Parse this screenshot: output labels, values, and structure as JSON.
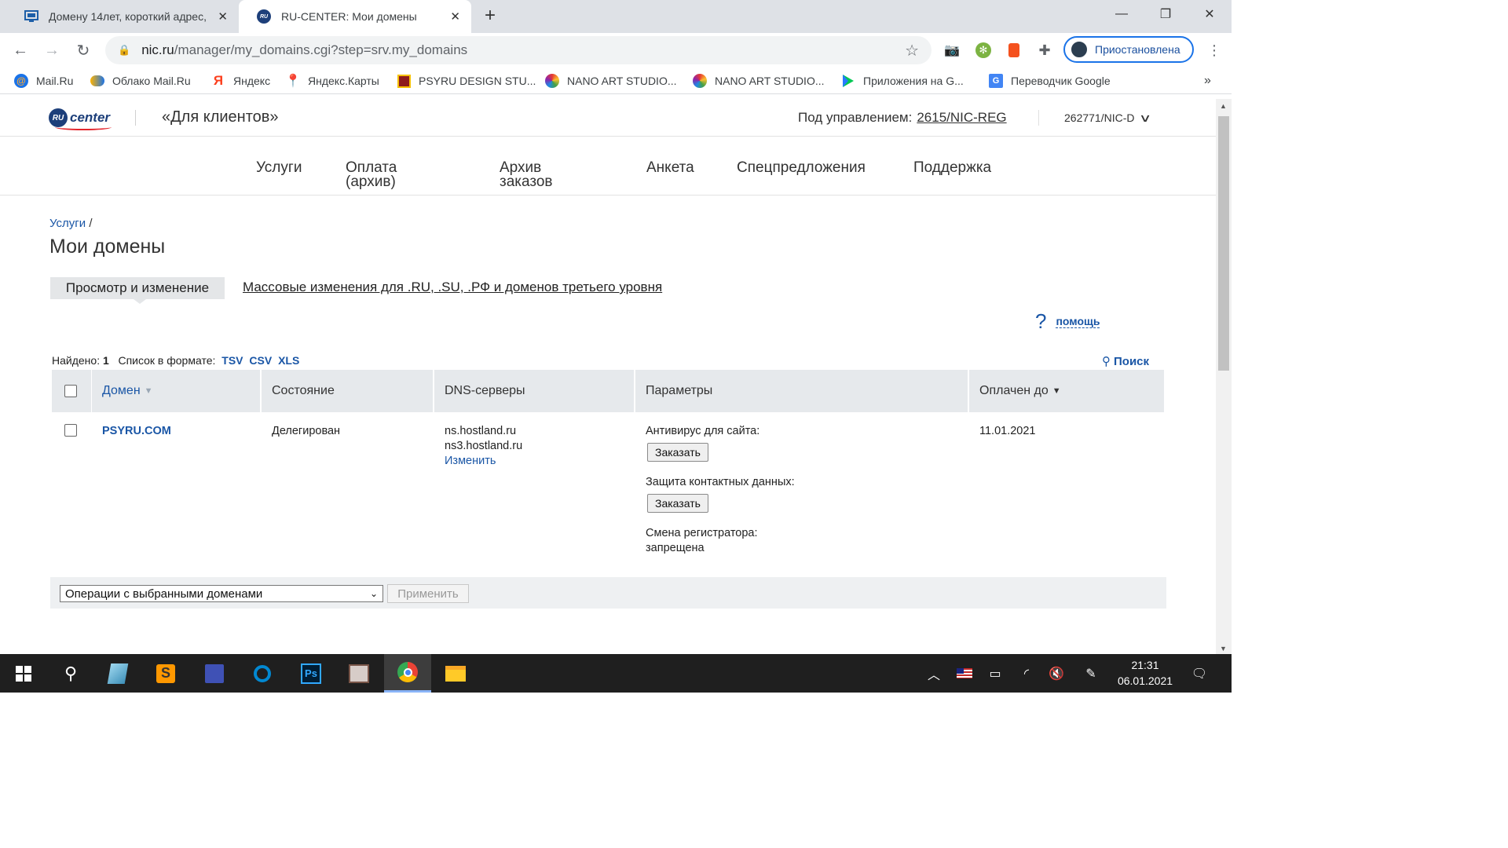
{
  "browser": {
    "tabs": [
      {
        "title": "Домену 14лет, короткий адрес,",
        "close": "✕"
      },
      {
        "title": "RU-CENTER: Мои домены",
        "close": "✕"
      }
    ],
    "new_tab": "+",
    "window_controls": {
      "minimize": "—",
      "maximize": "❐",
      "close": "✕"
    },
    "url_host": "nic.ru",
    "url_path": "/manager/my_domains.cgi?step=srv.my_domains",
    "profile_label": "Приостановлена",
    "bookmarks": [
      "Mail.Ru",
      "Облако Mail.Ru",
      "Яндекс",
      "Яндекс.Карты",
      "PSYRU DESIGN STU...",
      "NANO ART STUDIO...",
      "NANO ART STUDIO...",
      "Приложения на G...",
      "Переводчик Google"
    ],
    "bookmarks_more": "»"
  },
  "site": {
    "logo_badge": "RU",
    "logo_text": "center",
    "section": "«Для клиентов»",
    "managed_label": "Под управлением:",
    "managed_value": "2615/NIC-REG",
    "account": "262771/NIC-D",
    "nav": [
      {
        "line1": "Услуги",
        "line2": ""
      },
      {
        "line1": "Оплата",
        "line2": "(архив)"
      },
      {
        "line1": "Архив",
        "line2": "заказов"
      },
      {
        "line1": "Анкета",
        "line2": ""
      },
      {
        "line1": "Спецпредложения",
        "line2": ""
      },
      {
        "line1": "Поддержка",
        "line2": ""
      }
    ],
    "breadcrumb_link": "Услуги",
    "breadcrumb_sep": "/",
    "title": "Мои домены",
    "subtab_active": "Просмотр и изменение",
    "subtab_link": "Массовые изменения для .RU, .SU, .РФ и доменов третьего уровня",
    "help_q": "?",
    "help": "помощь",
    "found_label": "Найдено:",
    "found_count": "1",
    "format_label": "Список в формате:",
    "formats": [
      "TSV",
      "CSV",
      "XLS"
    ],
    "search": "Поиск",
    "table": {
      "headers": {
        "domain": "Домен",
        "state": "Состояние",
        "dns": "DNS-серверы",
        "params": "Параметры",
        "paid": "Оплачен до"
      },
      "rows": [
        {
          "domain": "PSYRU.COM",
          "state": "Делегирован",
          "dns": [
            "ns.hostland.ru",
            "ns3.hostland.ru"
          ],
          "dns_edit": "Изменить",
          "params": {
            "antivirus_label": "Антивирус для сайта:",
            "antivirus_btn": "Заказать",
            "privacy_label": "Защита контактных данных:",
            "privacy_btn": "Заказать",
            "transfer_label": "Смена регистратора:",
            "transfer_value": "запрещена"
          },
          "paid_until": "11.01.2021"
        }
      ]
    },
    "ops_select": "Операции с выбранными доменами",
    "apply": "Применить"
  },
  "taskbar": {
    "time": "21:31",
    "date": "06.01.2021"
  }
}
